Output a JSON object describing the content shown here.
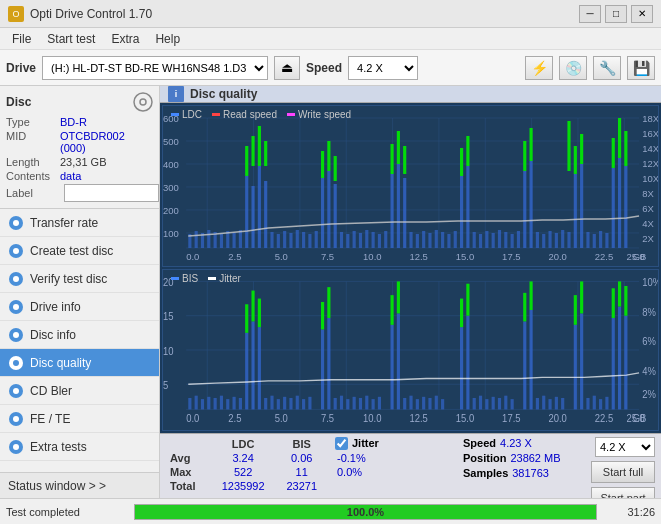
{
  "app": {
    "title": "Opti Drive Control 1.70",
    "icon": "O"
  },
  "menu": {
    "items": [
      "File",
      "Start test",
      "Extra",
      "Help"
    ]
  },
  "drive_bar": {
    "drive_label": "Drive",
    "drive_value": "(H:)  HL-DT-ST BD-RE  WH16NS48 1.D3",
    "speed_label": "Speed",
    "speed_value": "4.2 X"
  },
  "disc": {
    "header": "Disc",
    "type_label": "Type",
    "type_value": "BD-R",
    "mid_label": "MID",
    "mid_value": "OTCBDR002 (000)",
    "length_label": "Length",
    "length_value": "23,31 GB",
    "contents_label": "Contents",
    "contents_value": "data",
    "label_label": "Label",
    "label_value": ""
  },
  "nav": {
    "items": [
      {
        "id": "transfer-rate",
        "label": "Transfer rate",
        "active": false
      },
      {
        "id": "create-test-disc",
        "label": "Create test disc",
        "active": false
      },
      {
        "id": "verify-test-disc",
        "label": "Verify test disc",
        "active": false
      },
      {
        "id": "drive-info",
        "label": "Drive info",
        "active": false
      },
      {
        "id": "disc-info",
        "label": "Disc info",
        "active": false
      },
      {
        "id": "disc-quality",
        "label": "Disc quality",
        "active": true
      },
      {
        "id": "cd-bler",
        "label": "CD Bler",
        "active": false
      },
      {
        "id": "fe-te",
        "label": "FE / TE",
        "active": false
      },
      {
        "id": "extra-tests",
        "label": "Extra tests",
        "active": false
      }
    ],
    "status_window": "Status window > >"
  },
  "disc_quality": {
    "title": "Disc quality",
    "legend_top": {
      "ldc": "LDC",
      "read": "Read speed",
      "write": "Write speed"
    },
    "legend_bottom": {
      "bis": "BIS",
      "jitter": "Jitter"
    },
    "x_labels": [
      "0.0",
      "2.5",
      "5.0",
      "7.5",
      "10.0",
      "12.5",
      "15.0",
      "17.5",
      "20.0",
      "22.5",
      "25.0"
    ],
    "y_labels_top_left": [
      "600",
      "500",
      "400",
      "300",
      "200",
      "100"
    ],
    "y_labels_top_right": [
      "18X",
      "16X",
      "14X",
      "12X",
      "10X",
      "8X",
      "6X",
      "4X",
      "2X"
    ],
    "y_labels_bottom_left": [
      "20",
      "15",
      "10",
      "5"
    ],
    "y_labels_bottom_right": [
      "10%",
      "8%",
      "6%",
      "4%",
      "2%"
    ]
  },
  "stats": {
    "columns": [
      "",
      "LDC",
      "BIS",
      "",
      "Jitter",
      "Speed",
      ""
    ],
    "rows": [
      {
        "label": "Avg",
        "ldc": "3.24",
        "bis": "0.06",
        "jitter": "-0.1%",
        "speed_label": "Speed",
        "speed_value": "4.23 X"
      },
      {
        "label": "Max",
        "ldc": "522",
        "bis": "11",
        "jitter": "0.0%",
        "position_label": "Position",
        "position_value": "23862 MB"
      },
      {
        "label": "Total",
        "ldc": "1235992",
        "bis": "23271",
        "samples_label": "Samples",
        "samples_value": "381763"
      }
    ],
    "jitter_checked": true,
    "speed_select": "4.2 X",
    "start_full": "Start full",
    "start_part": "Start part"
  },
  "status_bar": {
    "status": "Test completed",
    "progress": 100,
    "progress_text": "100.0%",
    "time": "31:26"
  },
  "colors": {
    "active_nav": "#4a90d9",
    "ldc_bar": "#4488ff",
    "read_line": "#ff4444",
    "bis_bar": "#4488ff",
    "jitter_line": "#ffffff",
    "spike_green": "#00ff00",
    "progress_green": "#22cc22",
    "chart_bg": "#1e3d5c"
  }
}
